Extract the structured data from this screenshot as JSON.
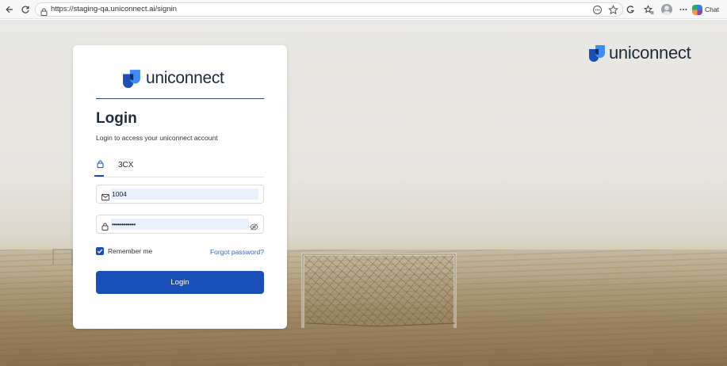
{
  "browser": {
    "url": "https://staging-qa.uniconnect.ai/signin",
    "chat_label": "Chat",
    "icons": [
      "back-icon",
      "refresh-icon",
      "lock-icon",
      "reader-icon",
      "favorite-icon",
      "extension-icon",
      "favorites-icon",
      "profile-avatar",
      "more-icon",
      "copilot-icon"
    ]
  },
  "brand": {
    "name": "uniconnect",
    "colors": {
      "dark": "#1c2a3a",
      "logo_blue": "#1a4fb8",
      "logo_light": "#3d8bfd"
    }
  },
  "login": {
    "title": "Login",
    "subtitle": "Login to access your uniconnect account",
    "tabs": [
      {
        "label": "3CX",
        "icon": "lock-icon",
        "active": true
      }
    ],
    "email": {
      "icon": "mail-icon",
      "value": "1004"
    },
    "password": {
      "icon": "lock-icon",
      "value": "••••••••••••",
      "toggle_icon": "eye-off-icon"
    },
    "remember_me": {
      "label": "Remember me",
      "checked": true
    },
    "forgot_password": "Forgot password?",
    "submit": "Login",
    "accent_color": "#1a4fb8"
  }
}
